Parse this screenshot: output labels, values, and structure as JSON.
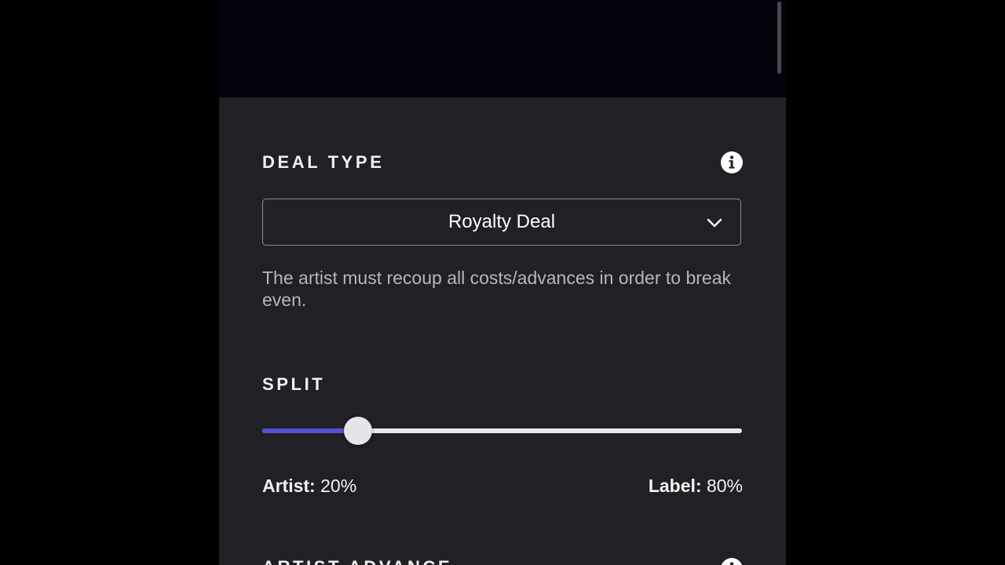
{
  "deal_type": {
    "title": "DEAL TYPE",
    "info_icon": "info-icon",
    "selected": "Royalty Deal",
    "dropdown_icon": "chevron-down-icon",
    "description": "The artist must recoup all costs/advances in order to break even."
  },
  "split": {
    "title": "SPLIT",
    "artist_percent": 20,
    "artist_label": "Artist:",
    "artist_value": "20%",
    "label_label": "Label:",
    "label_value": "80%"
  },
  "artist_advance": {
    "title": "ARTIST ADVANCE",
    "info_icon": "info-icon"
  },
  "colors": {
    "accent": "#5253d2",
    "panel_bg": "#212024",
    "page_bg": "#000000"
  }
}
